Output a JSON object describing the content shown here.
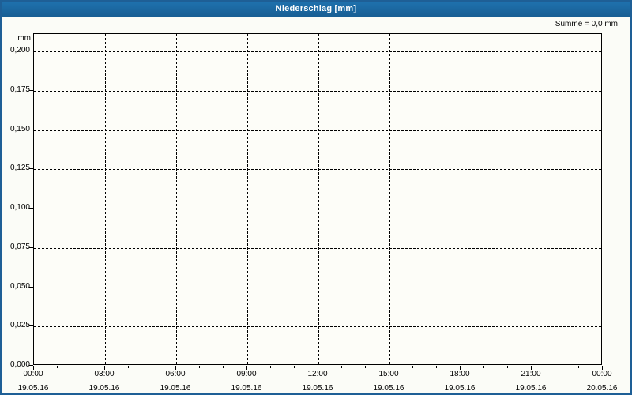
{
  "window": {
    "title": "Niederschlag [mm]"
  },
  "header": {
    "sum_label": "Summe = 0,0 mm"
  },
  "colors": {
    "titlebar_blue": "#1b69a3",
    "outer_border_blue": "#1e5f96",
    "page_background": "#fbfcf7",
    "plot_background": "#fdfdf8",
    "grid_color": "#000000",
    "title_text": "#ffffff",
    "label_text": "#000000"
  },
  "chart_data": {
    "type": "line",
    "title": "Niederschlag [mm]",
    "ylabel": "mm",
    "xlabel": "",
    "sum_annotation": "Summe = 0,0 mm",
    "grid": "dashed-on",
    "legend": "none",
    "ylim": [
      0,
      0.2111
    ],
    "y_ticks": [
      {
        "label": "0,200",
        "value": 0.2
      },
      {
        "label": "0,175",
        "value": 0.175
      },
      {
        "label": "0,150",
        "value": 0.15
      },
      {
        "label": "0,125",
        "value": 0.125
      },
      {
        "label": "0,100",
        "value": 0.1
      },
      {
        "label": "0,075",
        "value": 0.075
      },
      {
        "label": "0,050",
        "value": 0.05
      },
      {
        "label": "0,025",
        "value": 0.025
      },
      {
        "label": "0,000",
        "value": 0.0
      }
    ],
    "x_range_hours": 24,
    "x_major_tick_interval_hours": 3,
    "x_minor_tick_interval_hours": 1,
    "x_ticks": [
      {
        "time": "00:00",
        "date": "19.05.16"
      },
      {
        "time": "03:00",
        "date": "19.05.16"
      },
      {
        "time": "06:00",
        "date": "19.05.16"
      },
      {
        "time": "09:00",
        "date": "19.05.16"
      },
      {
        "time": "12:00",
        "date": "19.05.16"
      },
      {
        "time": "15:00",
        "date": "19.05.16"
      },
      {
        "time": "18:00",
        "date": "19.05.16"
      },
      {
        "time": "21:00",
        "date": "19.05.16"
      },
      {
        "time": "00:00",
        "date": "20.05.16"
      }
    ],
    "series": [
      {
        "name": "Niederschlag",
        "values": [],
        "sum": 0.0
      }
    ]
  }
}
